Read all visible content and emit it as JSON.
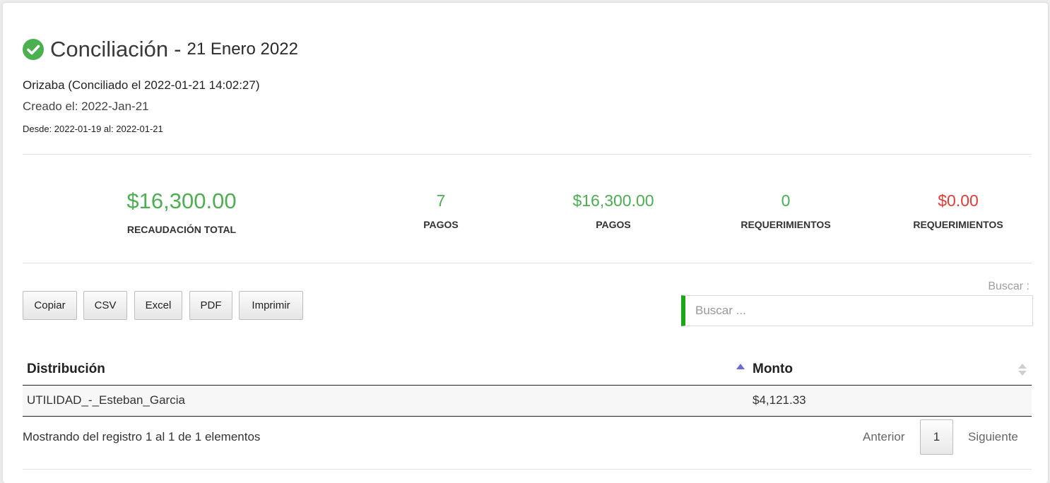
{
  "header": {
    "title": "Conciliación",
    "separator": "-",
    "date": "21 Enero 2022",
    "status_icon": "check-circle-icon",
    "status_color": "#4caf50"
  },
  "info": {
    "line1": "Orizaba (Conciliado el 2022-01-21 14:02:27)",
    "line2": "Creado el: 2022-Jan-21",
    "line3": "Desde: 2022-01-19 al: 2022-01-21"
  },
  "stats": {
    "total_value": "$16,300.00",
    "total_label": "RECAUDACIÓN TOTAL",
    "pagos_count": "7",
    "pagos_count_label": "PAGOS",
    "pagos_amount": "$16,300.00",
    "pagos_amount_label": "PAGOS",
    "req_count": "0",
    "req_count_label": "REQUERIMIENTOS",
    "req_amount": "$0.00",
    "req_amount_label": "REQUERIMIENTOS"
  },
  "toolbar": {
    "copy": "Copiar",
    "csv": "CSV",
    "excel": "Excel",
    "pdf": "PDF",
    "print": "Imprimir"
  },
  "search": {
    "label": "Buscar :",
    "placeholder": "Buscar ...",
    "value": ""
  },
  "table": {
    "columns": [
      "Distribución",
      "Monto"
    ],
    "rows": [
      [
        "UTILIDAD_-_Esteban_Garcia",
        "$4,121.33"
      ]
    ]
  },
  "footer": {
    "info": "Mostrando del registro 1 al 1 de 1 elementos",
    "prev": "Anterior",
    "current_page": "1",
    "next": "Siguiente"
  }
}
